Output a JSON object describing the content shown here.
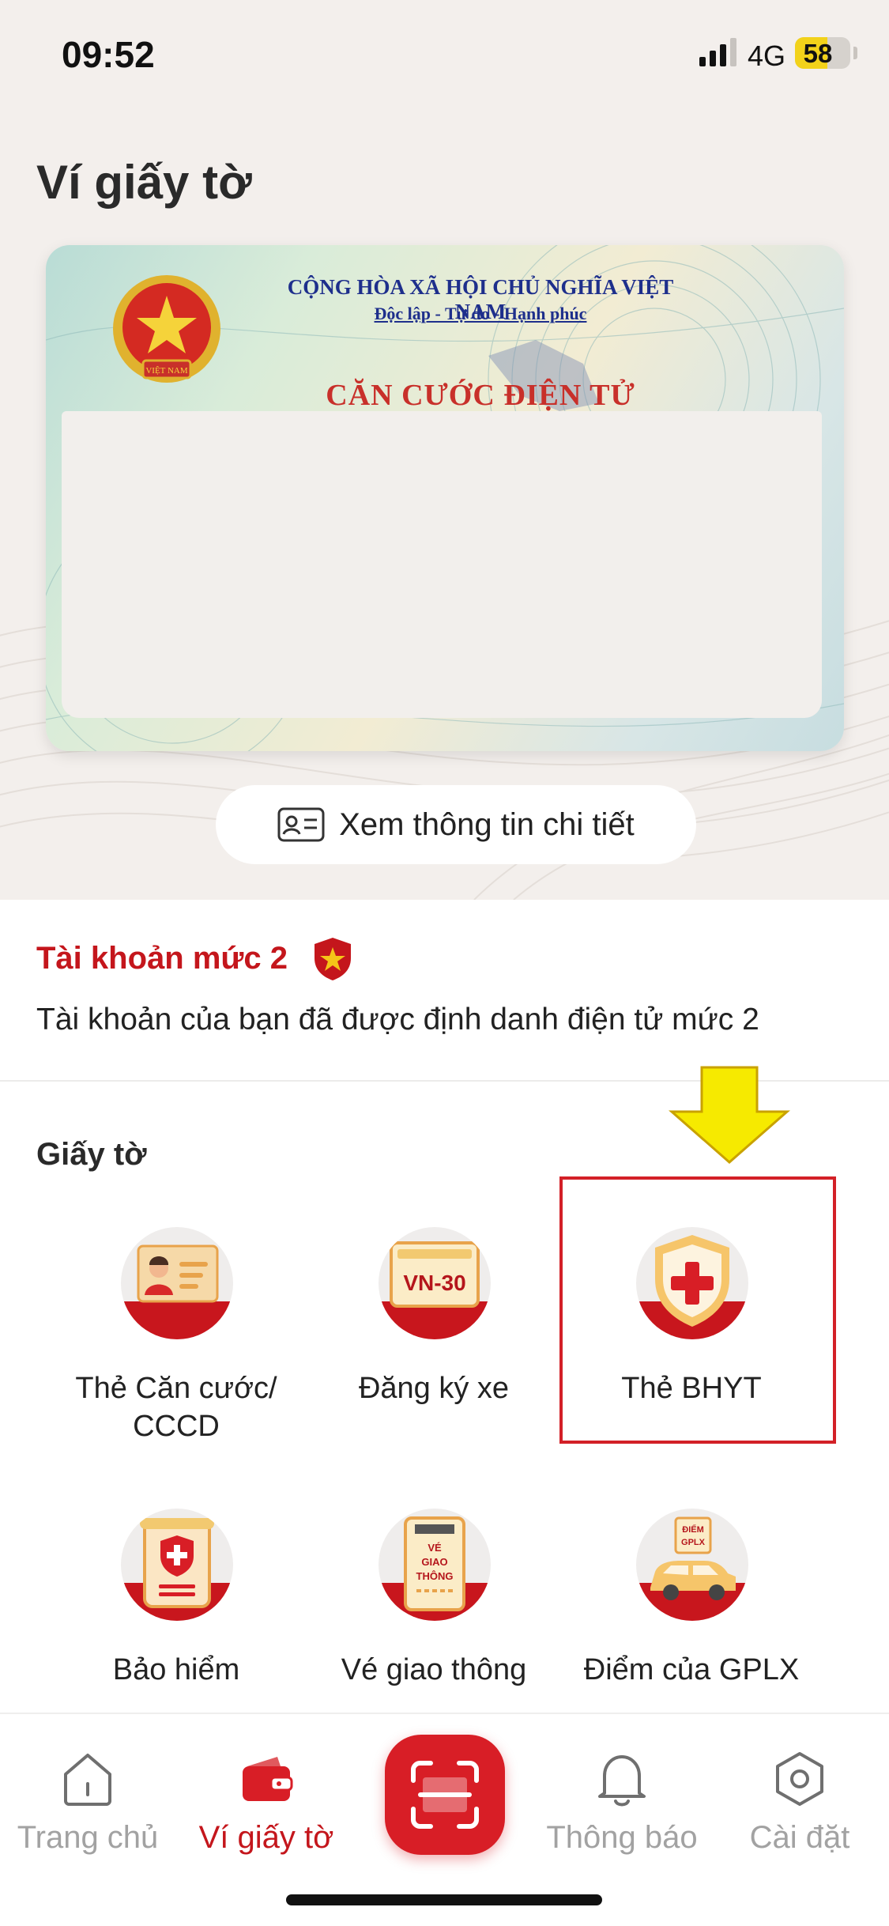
{
  "status_bar": {
    "time": "09:52",
    "network": "4G",
    "battery": "58",
    "battery_level": 0.58
  },
  "page_title": "Ví giấy tờ",
  "id_card": {
    "republic": "CỘNG HÒA XÃ HỘI CHỦ NGHĨA VIỆT NAM",
    "motto": "Độc lập - Tự do - Hạnh phúc",
    "title": "CĂN CƯỚC ĐIỆN TỬ",
    "emblem_text": "VIỆT NAM"
  },
  "detail_button": {
    "label": "Xem thông tin chi tiết",
    "icon": "id-card-icon"
  },
  "account": {
    "level_title": "Tài khoản mức 2",
    "badge_icon": "shield-star-icon",
    "description": "Tài khoản của bạn đã được định danh điện tử mức 2"
  },
  "documents": {
    "title": "Giấy tờ",
    "items": [
      {
        "label_line1": "Thẻ Căn cước/",
        "label_line2": "CCCD",
        "icon": "citizen-card-icon"
      },
      {
        "label_line1": "Đăng ký xe",
        "label_line2": "",
        "icon": "vehicle-plate-icon",
        "plate_text": "VN-30"
      },
      {
        "label_line1": "Thẻ BHYT",
        "label_line2": "",
        "icon": "health-insurance-shield-icon",
        "highlighted": true
      },
      {
        "label_line1": "Bảo hiểm",
        "label_line2": "",
        "icon": "insurance-document-icon"
      },
      {
        "label_line1": "Vé giao thông",
        "label_line2": "",
        "icon": "traffic-ticket-icon",
        "ticket_text": [
          "VÉ",
          "GIAO",
          "THÔNG"
        ]
      },
      {
        "label_line1": "Điểm của GPLX",
        "label_line2": "",
        "icon": "driving-license-points-icon",
        "sign_text": [
          "ĐIỂM",
          "GPLX"
        ]
      }
    ]
  },
  "bottom_nav": {
    "items": [
      {
        "label": "Trang chủ",
        "icon": "home-icon",
        "active": false
      },
      {
        "label": "Ví giấy tờ",
        "icon": "wallet-icon",
        "active": true
      },
      {
        "label": "",
        "icon": "scan-qr-icon",
        "active": false
      },
      {
        "label": "Thông báo",
        "icon": "bell-icon",
        "active": false
      },
      {
        "label": "Cài đặt",
        "icon": "settings-hex-icon",
        "active": false
      }
    ]
  },
  "colors": {
    "brand_red": "#c4161c",
    "highlight_red": "#d32027",
    "arrow_yellow": "#f6ea00",
    "background_beige": "#f3efec"
  }
}
